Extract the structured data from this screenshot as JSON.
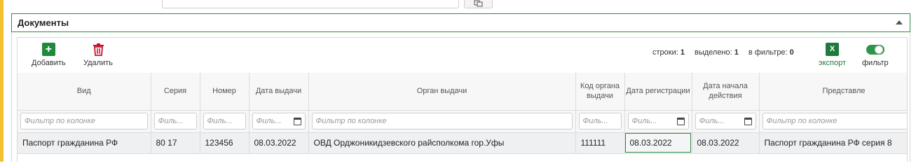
{
  "panel": {
    "title": "Документы"
  },
  "toolbar": {
    "add_label": "Добавить",
    "delete_label": "Удалить",
    "export_label": "экспорт",
    "filter_label": "фильтр",
    "excel_glyph": "X",
    "stats": {
      "rows_label": "строки:",
      "rows_value": "1",
      "selected_label": "выделено:",
      "selected_value": "1",
      "filtered_label": "в фильтре:",
      "filtered_value": "0"
    }
  },
  "columns": [
    {
      "label": "Вид",
      "filter_placeholder": "Фильтр по колонке",
      "calendar": false
    },
    {
      "label": "Серия",
      "filter_placeholder": "Филь...",
      "calendar": false
    },
    {
      "label": "Номер",
      "filter_placeholder": "Филь...",
      "calendar": false
    },
    {
      "label": "Дата выдачи",
      "filter_placeholder": "Филь...",
      "calendar": true
    },
    {
      "label": "Орган выдачи",
      "filter_placeholder": "Фильтр по колонке",
      "calendar": false
    },
    {
      "label": "Код органа выдачи",
      "filter_placeholder": "Филь...",
      "calendar": false
    },
    {
      "label": "Дата регистрации",
      "filter_placeholder": "Филь...",
      "calendar": true
    },
    {
      "label": "Дата начала действия",
      "filter_placeholder": "Филь...",
      "calendar": true
    },
    {
      "label": "Представле",
      "filter_placeholder": "Фильтр по колонке",
      "calendar": false
    }
  ],
  "rows": [
    [
      "Паспорт гражданина РФ",
      "80 17",
      "123456",
      "08.03.2022",
      "ОВД Орджоникидзевского райсполкома гор.Уфы",
      "111111",
      "08.03.2022",
      "08.03.2022",
      "Паспорт гражданина РФ серия 8"
    ]
  ],
  "colors": {
    "accent": "#2d8a3e",
    "add": "#1f8a3c",
    "delete": "#c8102e",
    "side_marker": "#f5c02e"
  }
}
